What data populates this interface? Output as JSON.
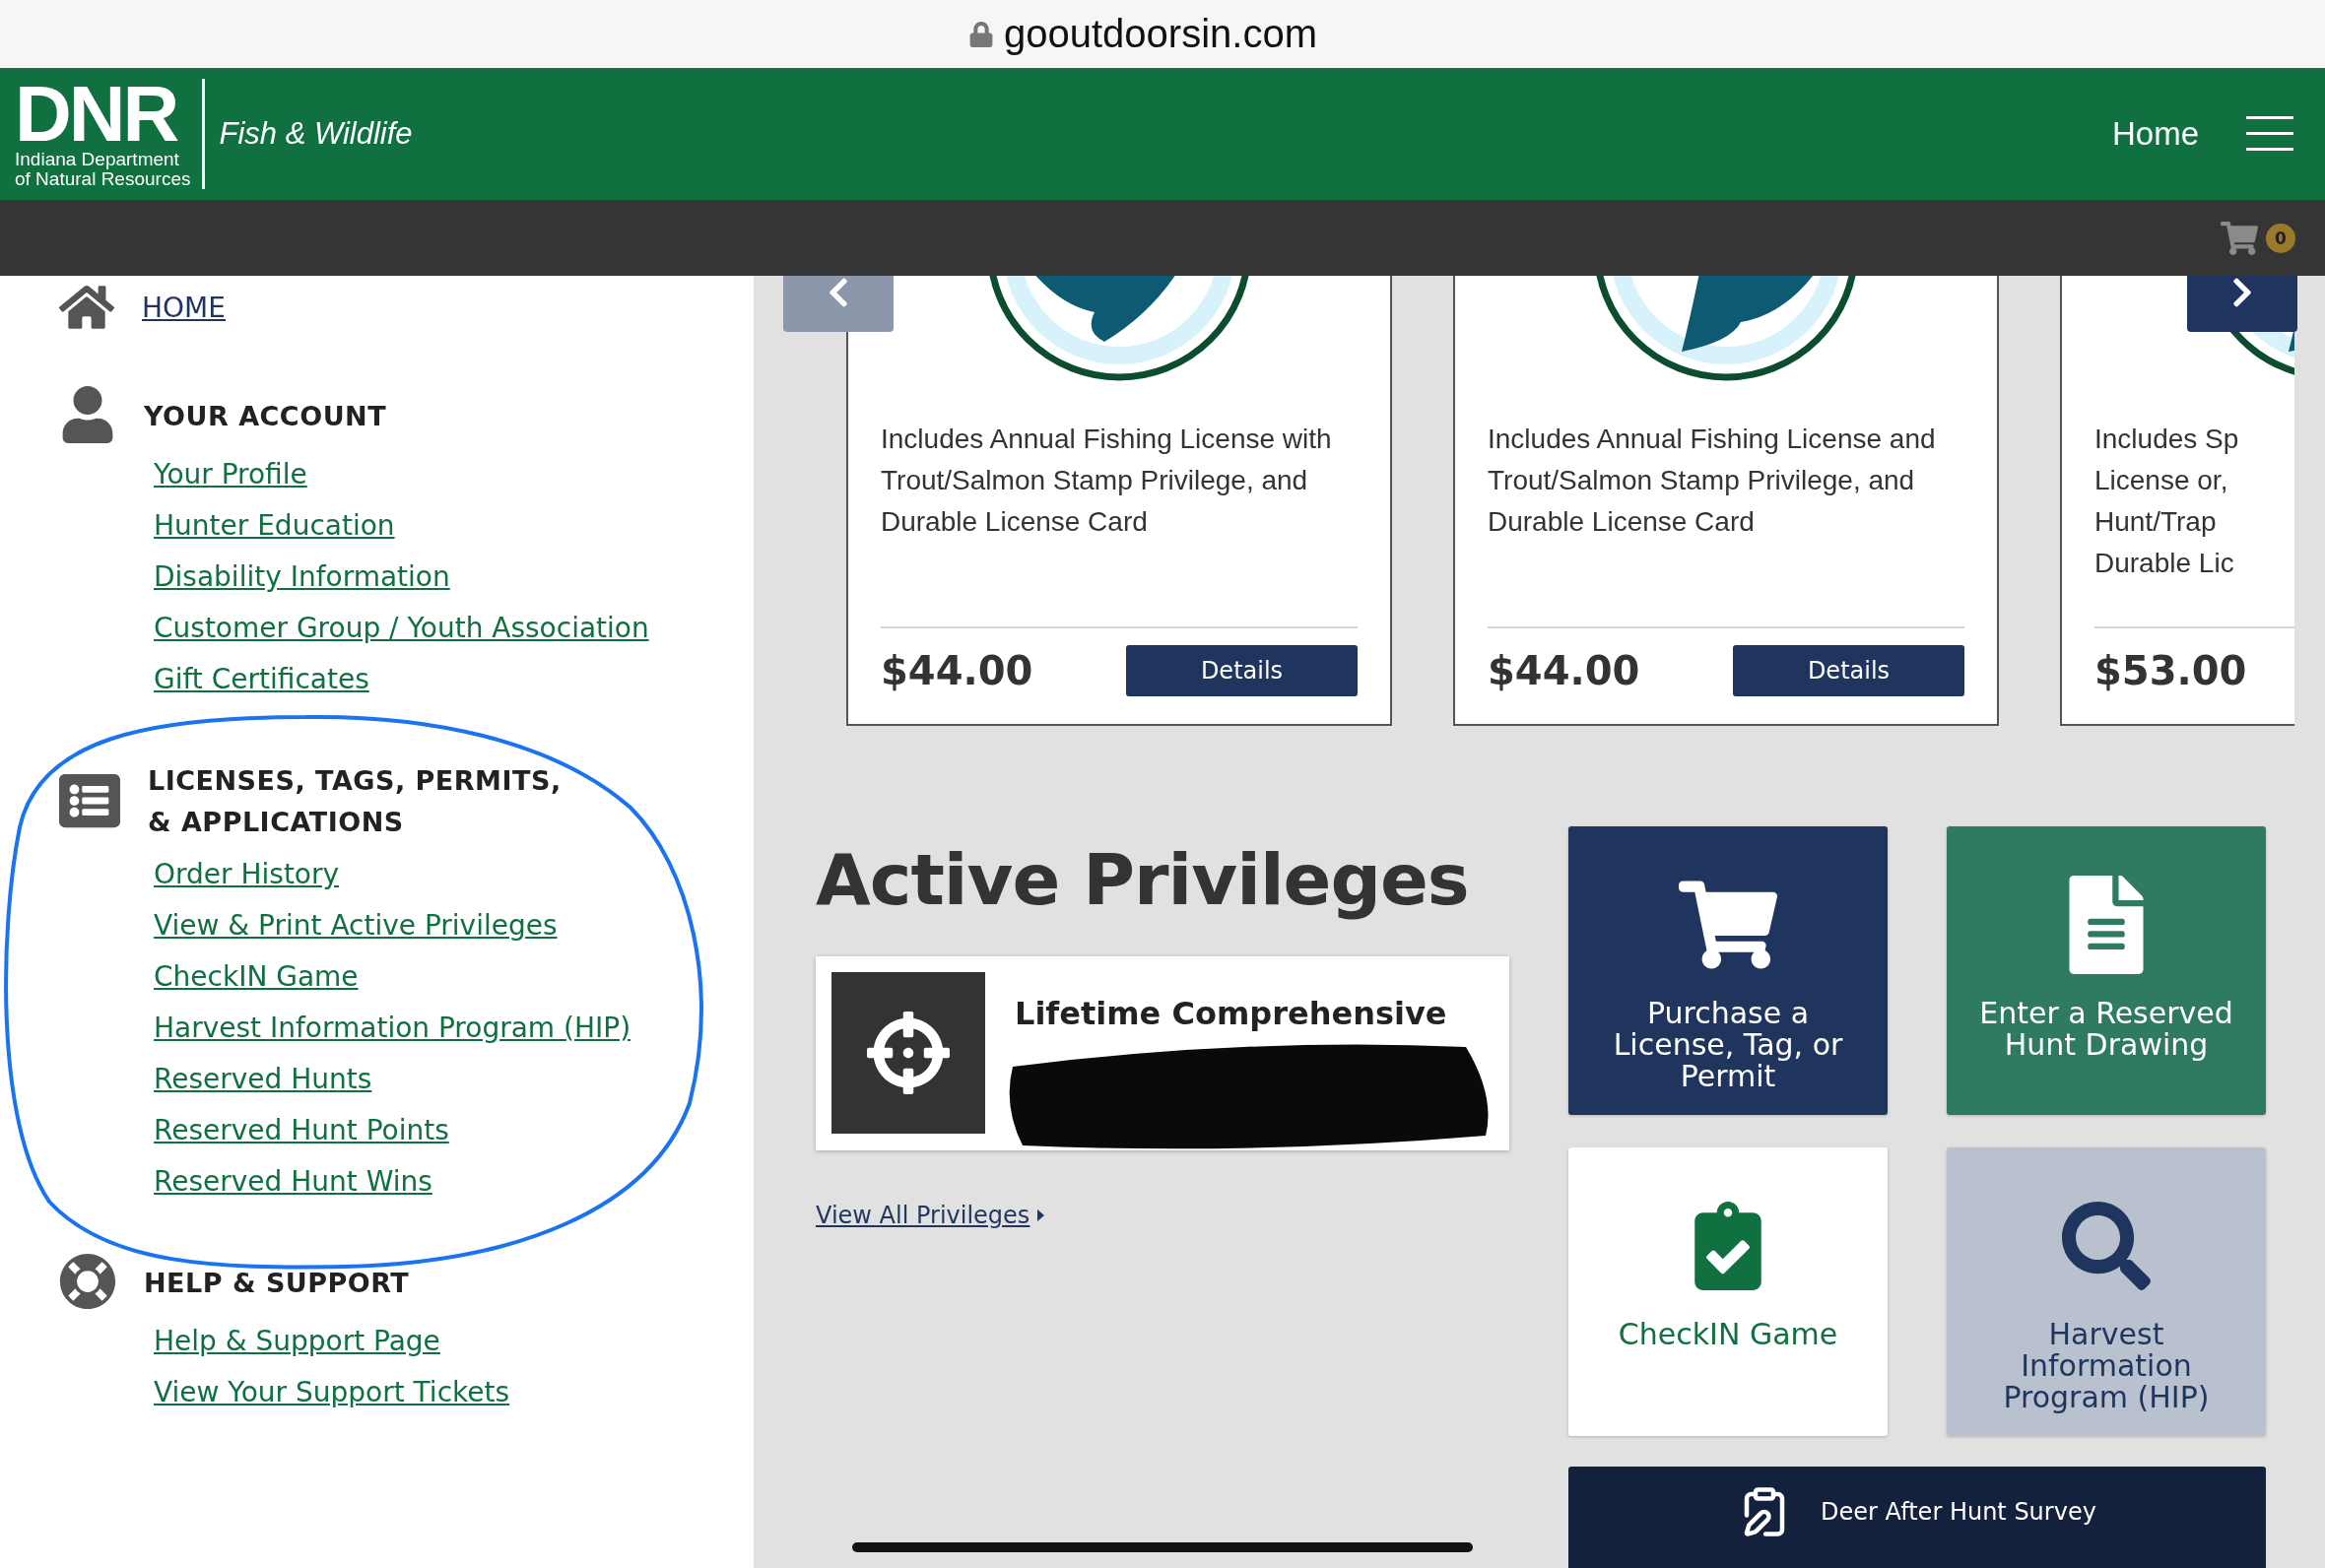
{
  "browser": {
    "url": "gooutdoorsin.com"
  },
  "header": {
    "logo_mark": "DNR",
    "logo_subtitle": [
      "Indiana Department",
      "of Natural Resources"
    ],
    "section_title": "Fish & Wildlife",
    "nav_link": "Home"
  },
  "cart": {
    "count": "0"
  },
  "sidebar": {
    "home_link": "HOME",
    "groups": [
      {
        "kind": "account",
        "title": "YOUR ACCOUNT",
        "links": [
          "Your Profile",
          "Hunter Education",
          "Disability Information",
          "Customer Group / Youth Association",
          "Gift Certificates"
        ]
      },
      {
        "kind": "licenses",
        "title": "LICENSES, TAGS, PERMITS, & APPLICATIONS",
        "links": [
          "Order History",
          "View & Print Active Privileges",
          "CheckIN Game",
          "Harvest Information Program (HIP)",
          "Reserved Hunts",
          "Reserved Hunt Points",
          "Reserved Hunt Wins"
        ]
      },
      {
        "kind": "support",
        "title": "HELP & SUPPORT",
        "links": [
          "Help & Support Page",
          "View Your Support Tickets"
        ]
      }
    ]
  },
  "carousel": {
    "cards": [
      {
        "description_lines": [
          "Includes Annual Fishing License with",
          "Trout/Salmon Stamp Privilege, and",
          "Durable License Card"
        ],
        "price": "$44.00",
        "button": "Details"
      },
      {
        "description_lines": [
          "Includes Annual Fishing License and",
          "Trout/Salmon Stamp Privilege, and",
          "Durable License Card"
        ],
        "price": "$44.00",
        "button": "Details"
      },
      {
        "description_lines": [
          "Includes Sp",
          "License or,",
          "Hunt/Trap",
          "Durable Lic"
        ],
        "price": "$53.00"
      }
    ]
  },
  "privileges": {
    "title": "Active Privileges",
    "items": [
      {
        "name": "Lifetime Comprehensive",
        "redacted": true
      }
    ],
    "view_all": "View All Privileges"
  },
  "tiles": [
    {
      "kind": "purchase",
      "label": "Purchase a License, Tag, or Permit"
    },
    {
      "kind": "drawing",
      "label": "Enter a Reserved Hunt Drawing"
    },
    {
      "kind": "checkin",
      "label": "CheckIN Game"
    },
    {
      "kind": "hip",
      "label": "Harvest Information Program (HIP)"
    }
  ],
  "survey": {
    "label": "Deer After Hunt Survey"
  },
  "annotation": {
    "circled": true
  }
}
